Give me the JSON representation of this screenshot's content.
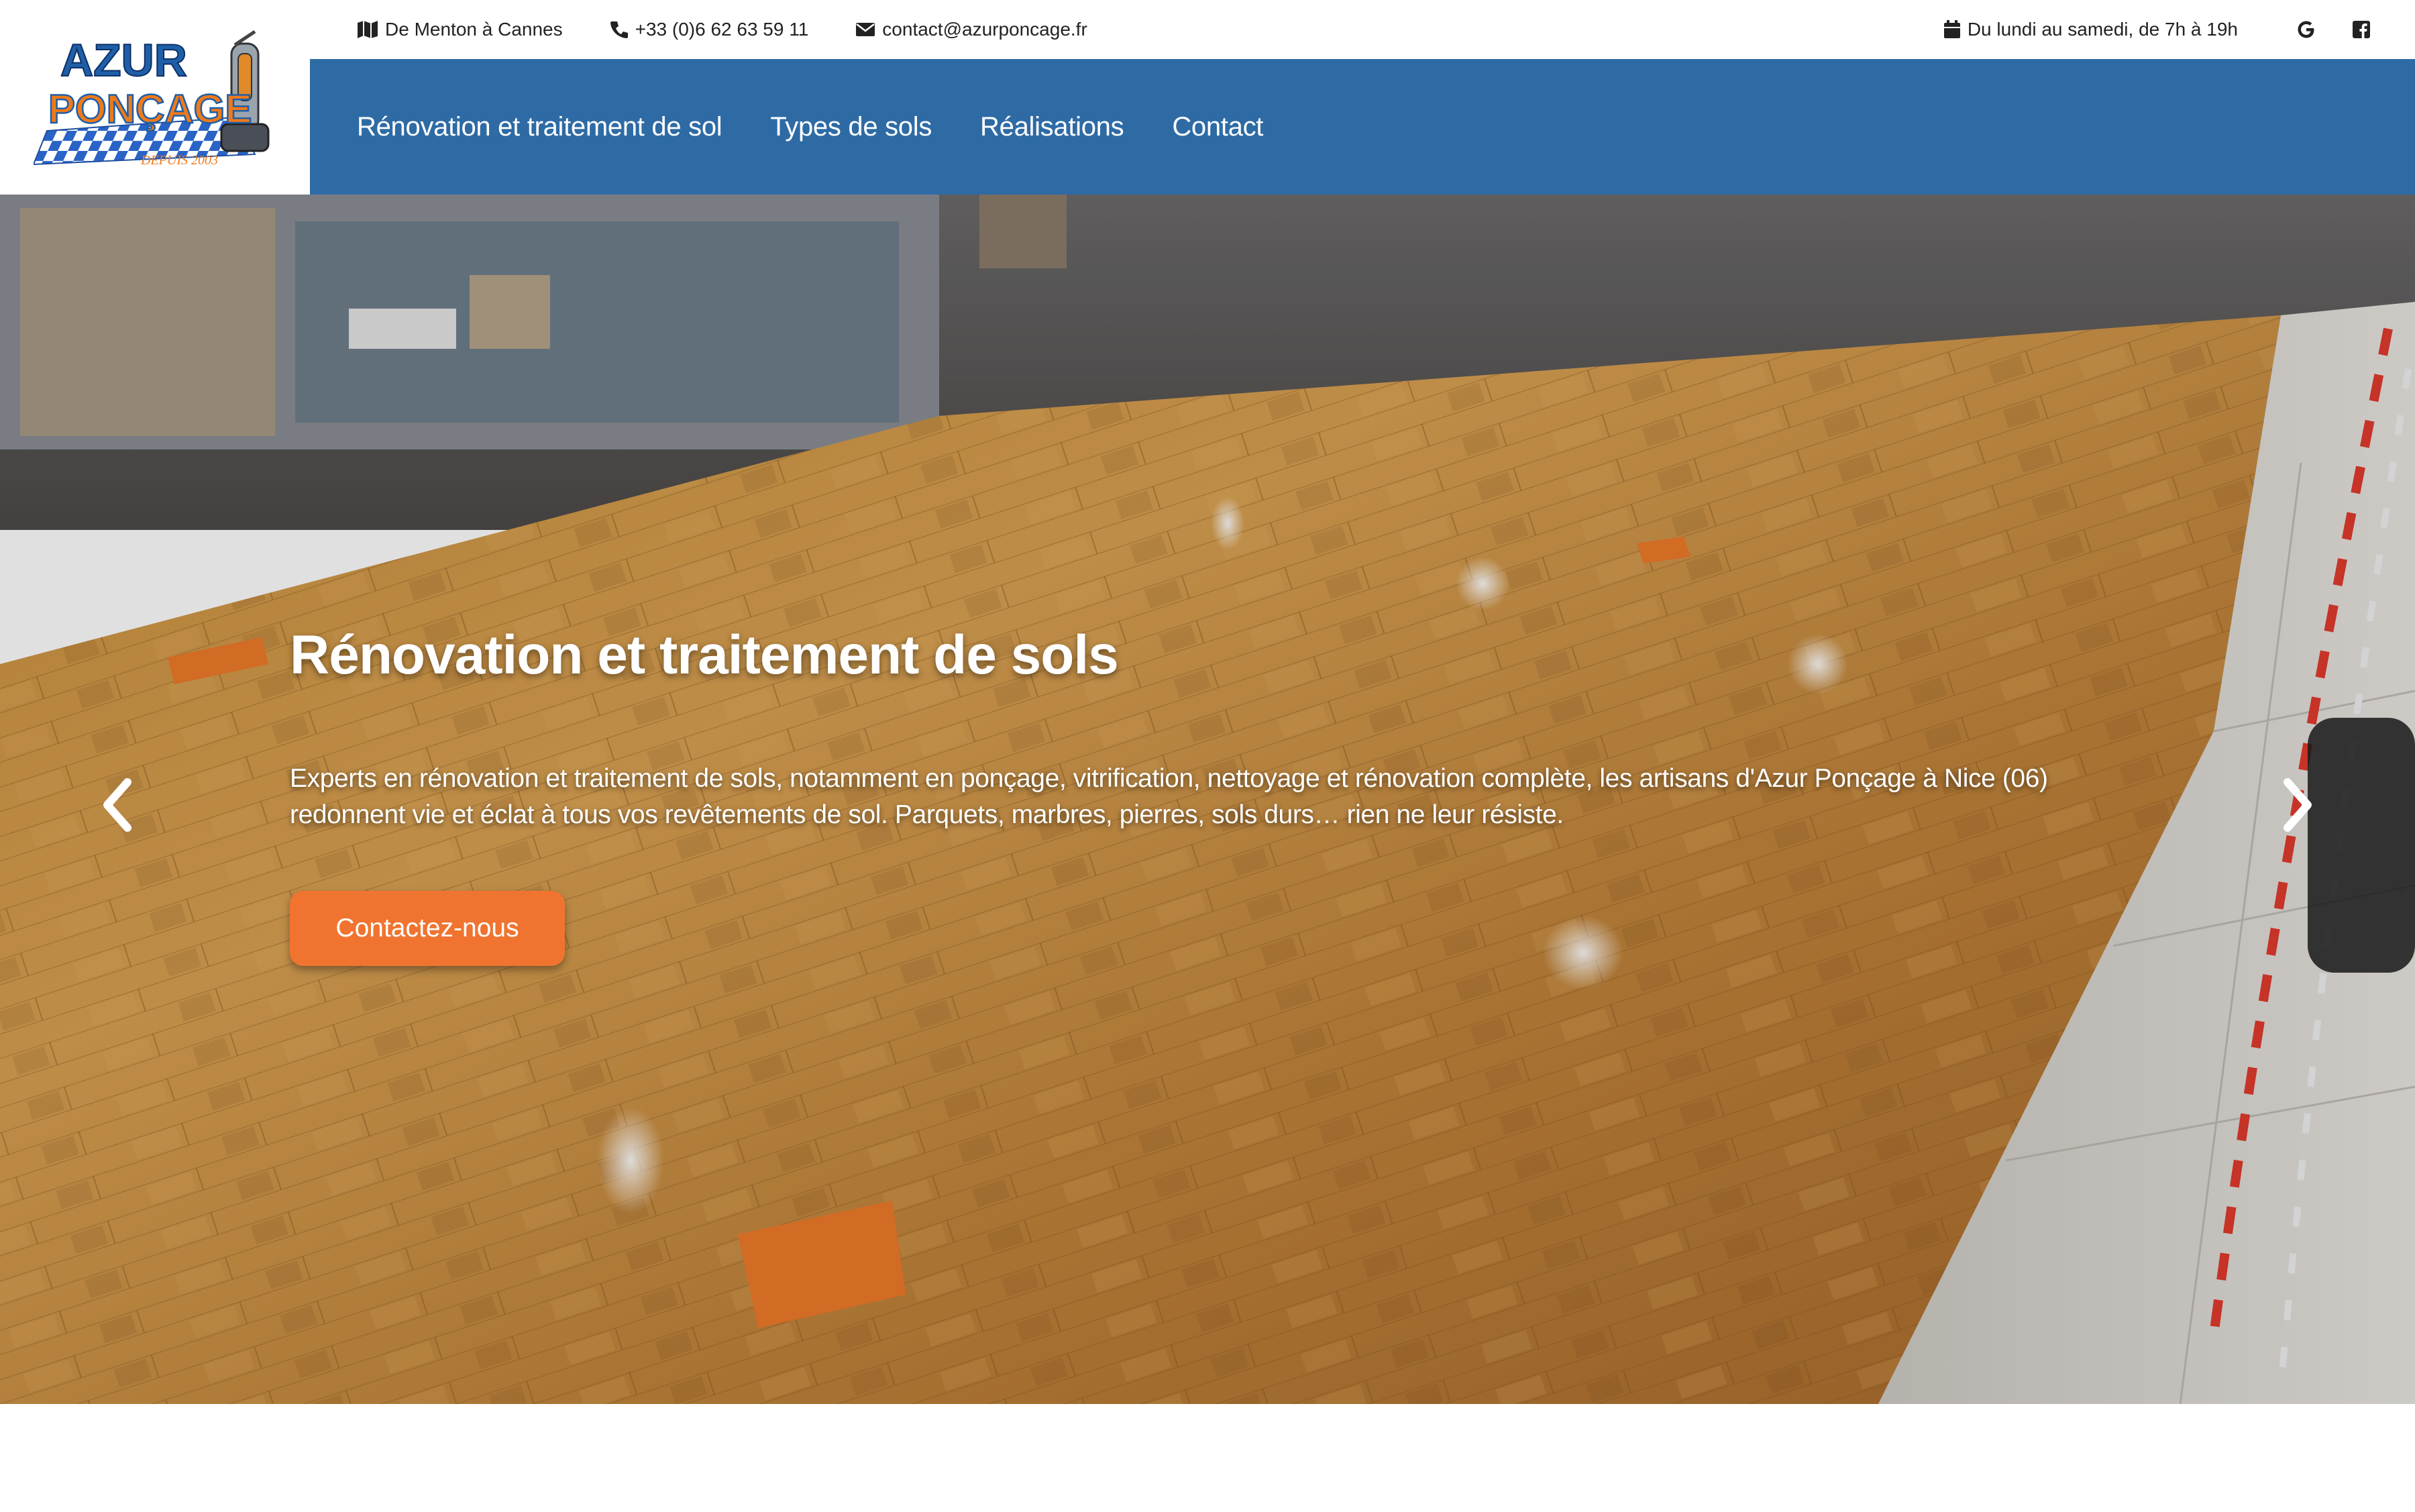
{
  "brand": {
    "logo_line1": "AZUR",
    "logo_line2": "PONÇAGE",
    "logo_since": "DEPUIS 2003"
  },
  "topbar": {
    "area": "De Menton à Cannes",
    "phone": "+33 (0)6 62 63 59 11",
    "email": "contact@azurponcage.fr",
    "hours": "Du lundi au samedi, de 7h à 19h",
    "icons": [
      "map-icon",
      "phone-icon",
      "envelope-icon",
      "calendar-icon",
      "google-icon",
      "facebook-icon"
    ]
  },
  "nav": {
    "items": [
      {
        "label": "Rénovation et traitement de sol"
      },
      {
        "label": "Types de sols"
      },
      {
        "label": "Réalisations"
      },
      {
        "label": "Contact"
      }
    ]
  },
  "hero": {
    "title": "Rénovation et traitement de sols",
    "text": "Experts en rénovation et traitement de sols, notamment en ponçage, vitrification, nettoyage et rénovation complète, les artisans d'Azur Ponçage à Nice (06) redonnent vie et éclat à tous vos revêtements de sol. Parquets, marbres, pierres, sols durs… rien ne leur résiste.",
    "button": "Contactez-nous",
    "icons": [
      "chevron-left-icon",
      "chevron-right-icon"
    ]
  },
  "colors": {
    "nav_bg": "#2e6ba5",
    "button": "#f07430",
    "logo_blue": "#1f5fa8",
    "logo_orange": "#ef7a1a"
  }
}
